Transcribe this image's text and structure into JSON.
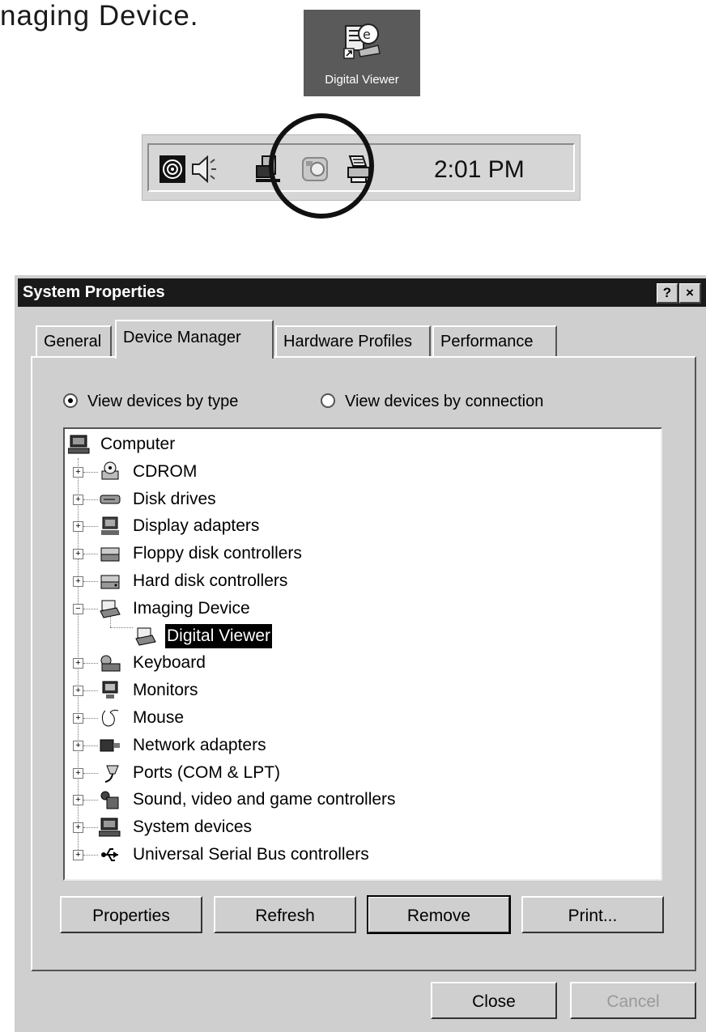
{
  "caption": "naging Device.",
  "desktop_icon": {
    "label": "Digital Viewer",
    "icon": "digital-viewer-icon"
  },
  "tray": {
    "icons": [
      "speaker-sound-icon",
      "volume-icon",
      "network-icon",
      "imaging-device-icon",
      "printer-icon"
    ],
    "time": "2:01 PM"
  },
  "dialog": {
    "title": "System Properties",
    "help_button": "?",
    "close_button": "×",
    "tabs": [
      "General",
      "Device Manager",
      "Hardware Profiles",
      "Performance"
    ],
    "active_tab": "Device Manager",
    "radios": [
      {
        "label": "View devices by type",
        "checked": true
      },
      {
        "label": "View devices by connection",
        "checked": false
      }
    ],
    "tree": {
      "root": "Computer",
      "items": [
        {
          "label": "CDROM",
          "icon": "cdrom-icon"
        },
        {
          "label": "Disk drives",
          "icon": "disk-drive-icon"
        },
        {
          "label": "Display adapters",
          "icon": "display-adapter-icon"
        },
        {
          "label": "Floppy disk controllers",
          "icon": "floppy-controller-icon"
        },
        {
          "label": "Hard disk controllers",
          "icon": "hard-disk-controller-icon"
        },
        {
          "label": "Imaging Device",
          "icon": "imaging-device-icon",
          "expanded": true,
          "children": [
            {
              "label": "Digital Viewer",
              "selected": true
            }
          ]
        },
        {
          "label": "Keyboard",
          "icon": "keyboard-icon"
        },
        {
          "label": "Monitors",
          "icon": "monitor-icon"
        },
        {
          "label": "Mouse",
          "icon": "mouse-icon"
        },
        {
          "label": "Network adapters",
          "icon": "network-adapter-icon"
        },
        {
          "label": "Ports (COM & LPT)",
          "icon": "port-icon"
        },
        {
          "label": "Sound, video and game controllers",
          "icon": "sound-icon"
        },
        {
          "label": "System devices",
          "icon": "system-device-icon"
        },
        {
          "label": "Universal Serial Bus controllers",
          "icon": "usb-icon"
        }
      ]
    },
    "buttons": [
      "Properties",
      "Refresh",
      "Remove",
      "Print..."
    ],
    "footer_buttons": [
      "Close",
      "Cancel"
    ]
  }
}
